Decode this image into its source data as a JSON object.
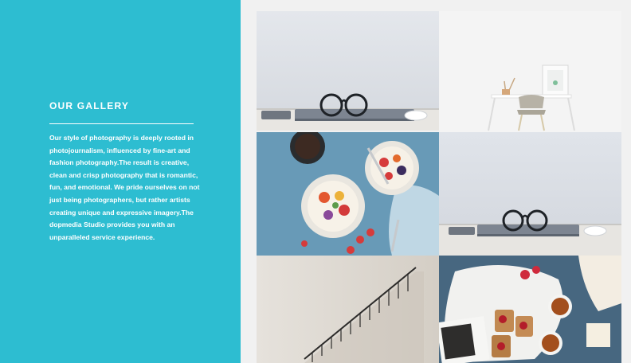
{
  "gallery_section": {
    "title": "OUR GALLERY",
    "description": "Our style of photography is deeply rooted in photojournalism, influenced by fine-art and fashion photography.The result is creative, clean and crisp photography that is romantic, fun, and emotional. We pride ourselves on not just being photographers, but rather artists creating unique and expressive imagery.The dopmedia Studio provides you with an unparalleled service experience."
  },
  "colors": {
    "sidebar_background": "#2dbdd1",
    "page_background": "#f1f1f1",
    "text": "#ffffff"
  },
  "photos": [
    {
      "name": "glasses-on-laptop-desk"
    },
    {
      "name": "white-desk-and-chair"
    },
    {
      "name": "breakfast-bowls-with-berries"
    },
    {
      "name": "glasses-on-laptop-desk"
    },
    {
      "name": "staircase-wall"
    },
    {
      "name": "toast-and-tea-flatlay"
    }
  ]
}
